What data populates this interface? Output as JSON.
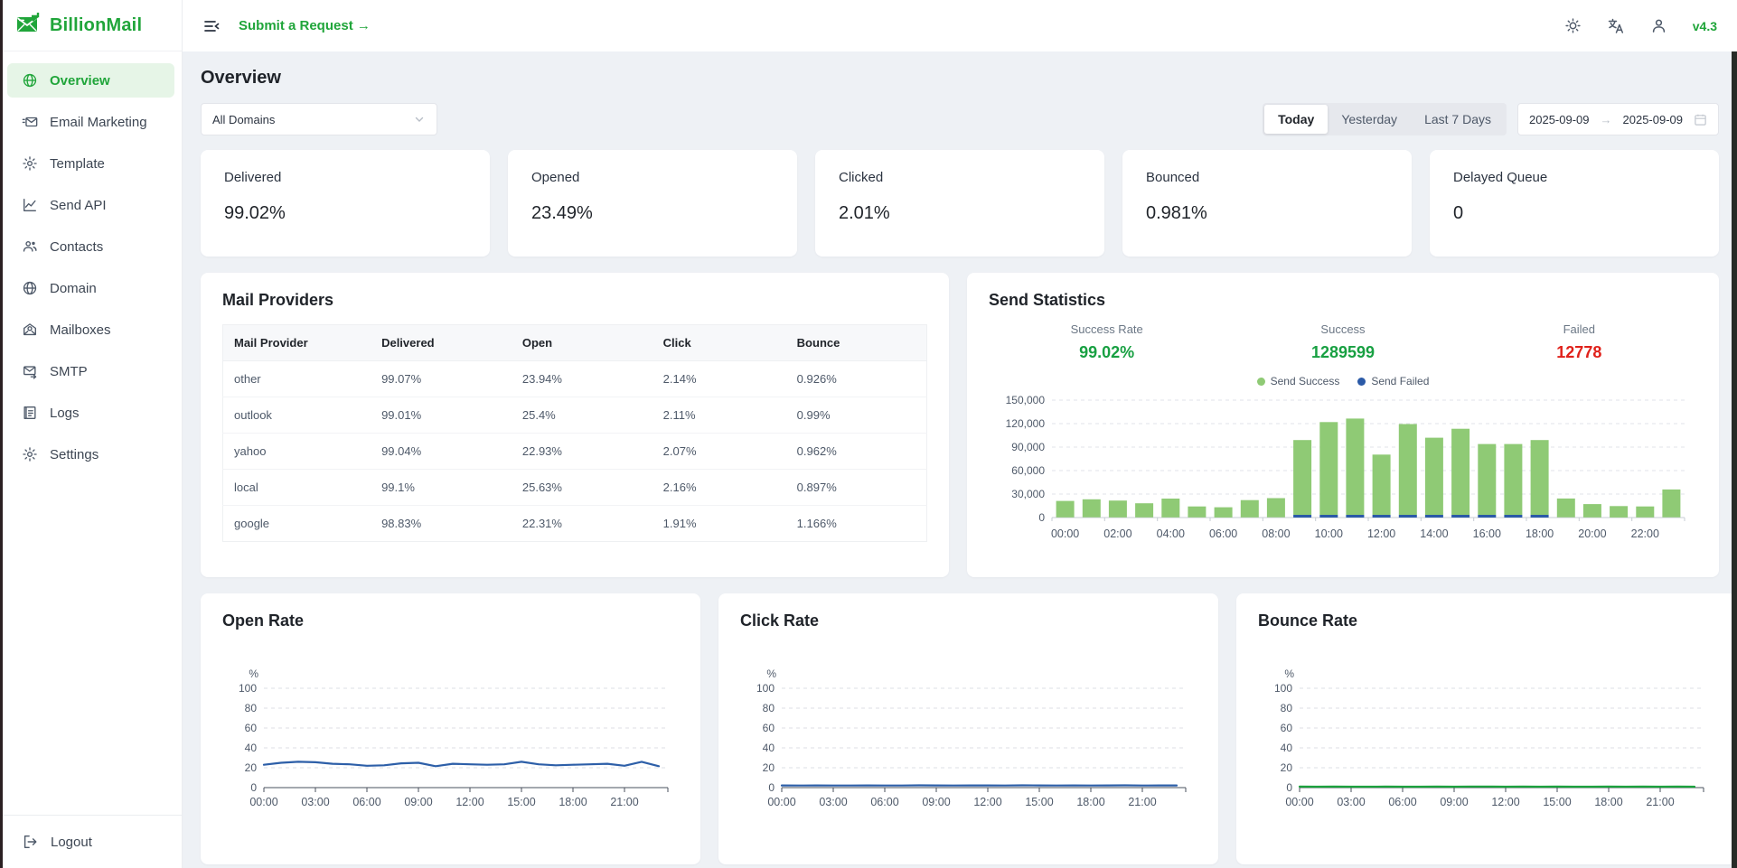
{
  "app": {
    "name": "BillionMail",
    "version": "v4.3"
  },
  "topbar": {
    "submit_request": "Submit a Request →"
  },
  "sidebar": {
    "items": [
      {
        "label": "Overview",
        "icon": "globe-icon",
        "active": true
      },
      {
        "label": "Email Marketing",
        "icon": "email-campaign-icon",
        "active": false
      },
      {
        "label": "Template",
        "icon": "gear-icon",
        "active": false
      },
      {
        "label": "Send API",
        "icon": "chart-line-icon",
        "active": false
      },
      {
        "label": "Contacts",
        "icon": "contacts-icon",
        "active": false
      },
      {
        "label": "Domain",
        "icon": "globe-icon",
        "active": false
      },
      {
        "label": "Mailboxes",
        "icon": "mailbox-icon",
        "active": false
      },
      {
        "label": "SMTP",
        "icon": "envelope-arrow-icon",
        "active": false
      },
      {
        "label": "Logs",
        "icon": "logs-icon",
        "active": false
      },
      {
        "label": "Settings",
        "icon": "gear-icon",
        "active": false
      }
    ],
    "logout_label": "Logout"
  },
  "page": {
    "title": "Overview"
  },
  "filters": {
    "domain_select": {
      "value": "All Domains"
    },
    "range_tabs": [
      {
        "label": "Today",
        "active": true
      },
      {
        "label": "Yesterday",
        "active": false
      },
      {
        "label": "Last 7 Days",
        "active": false
      }
    ],
    "date_from": "2025-09-09",
    "date_arrow": "→",
    "date_to": "2025-09-09"
  },
  "stat_cards": [
    {
      "label": "Delivered",
      "value": "99.02%"
    },
    {
      "label": "Opened",
      "value": "23.49%"
    },
    {
      "label": "Clicked",
      "value": "2.01%"
    },
    {
      "label": "Bounced",
      "value": "0.981%"
    },
    {
      "label": "Delayed Queue",
      "value": "0"
    }
  ],
  "mail_providers": {
    "title": "Mail Providers",
    "columns": [
      "Mail Provider",
      "Delivered",
      "Open",
      "Click",
      "Bounce"
    ],
    "rows": [
      [
        "other",
        "99.07%",
        "23.94%",
        "2.14%",
        "0.926%"
      ],
      [
        "outlook",
        "99.01%",
        "25.4%",
        "2.11%",
        "0.99%"
      ],
      [
        "yahoo",
        "99.04%",
        "22.93%",
        "2.07%",
        "0.962%"
      ],
      [
        "local",
        "99.1%",
        "25.63%",
        "2.16%",
        "0.897%"
      ],
      [
        "google",
        "98.83%",
        "22.31%",
        "1.91%",
        "1.166%"
      ]
    ]
  },
  "send_statistics": {
    "title": "Send Statistics",
    "stats": [
      {
        "label": "Success Rate",
        "value": "99.02%",
        "color": "#18a042"
      },
      {
        "label": "Success",
        "value": "1289599",
        "color": "#18a042"
      },
      {
        "label": "Failed",
        "value": "12778",
        "color": "#e0211a"
      }
    ],
    "legend": [
      {
        "label": "Send Success",
        "color": "#8fca75"
      },
      {
        "label": "Send Failed",
        "color": "#2b5aa7"
      }
    ]
  },
  "colors": {
    "accent_green": "#20a53a",
    "bar_green": "#8fca75",
    "failed_blue": "#2b5aa7",
    "line_blue": "#2d5fa8",
    "line_green": "#1ba13d",
    "success_text": "#18a042",
    "failed_text": "#e0211a"
  },
  "chart_data": [
    {
      "id": "send_stats_bar",
      "type": "bar",
      "title": "Send Statistics",
      "stacked": true,
      "x": [
        "00:00",
        "01:00",
        "02:00",
        "03:00",
        "04:00",
        "05:00",
        "06:00",
        "07:00",
        "08:00",
        "09:00",
        "10:00",
        "11:00",
        "12:00",
        "13:00",
        "14:00",
        "15:00",
        "16:00",
        "17:00",
        "18:00",
        "19:00",
        "20:00",
        "21:00",
        "22:00",
        "23:00"
      ],
      "xtick_every": 2,
      "series": [
        {
          "name": "Send Failed",
          "color": "#2b5aa7",
          "values": [
            250,
            250,
            250,
            200,
            250,
            150,
            150,
            250,
            300,
            1200,
            1500,
            1500,
            1000,
            1400,
            1300,
            1400,
            1200,
            1200,
            1200,
            300,
            200,
            150,
            150,
            400
          ]
        },
        {
          "name": "Send Success",
          "color": "#8fca75",
          "values": [
            21000,
            23000,
            21500,
            18000,
            24000,
            14000,
            13000,
            22000,
            24500,
            95500,
            118500,
            123000,
            77000,
            116000,
            98500,
            110000,
            90500,
            90500,
            95500,
            24000,
            17000,
            14500,
            14000,
            35500
          ]
        }
      ],
      "ylim": [
        0,
        150000
      ],
      "yticks": [
        0,
        30000,
        60000,
        90000,
        120000,
        150000
      ],
      "grid": true,
      "legend_position": "top"
    },
    {
      "id": "open_rate",
      "type": "line",
      "title": "Open Rate",
      "color": "#2d5fa8",
      "ylabel": "%",
      "x": [
        "00:00",
        "01:00",
        "02:00",
        "03:00",
        "04:00",
        "05:00",
        "06:00",
        "07:00",
        "08:00",
        "09:00",
        "10:00",
        "11:00",
        "12:00",
        "13:00",
        "14:00",
        "15:00",
        "16:00",
        "17:00",
        "18:00",
        "19:00",
        "20:00",
        "21:00",
        "22:00",
        "23:00"
      ],
      "xtick_every": 3,
      "values": [
        23,
        25,
        26,
        25.5,
        24,
        23.5,
        22,
        22.5,
        24.5,
        25,
        21.5,
        24,
        23.5,
        23,
        23.5,
        26,
        23.5,
        22.5,
        23,
        23.5,
        24,
        22,
        26,
        21.5
      ],
      "ylim": [
        0,
        100
      ],
      "yticks": [
        0,
        20,
        40,
        60,
        80,
        100
      ],
      "grid": true
    },
    {
      "id": "click_rate",
      "type": "line",
      "title": "Click Rate",
      "color": "#2d5fa8",
      "ylabel": "%",
      "x": [
        "00:00",
        "01:00",
        "02:00",
        "03:00",
        "04:00",
        "05:00",
        "06:00",
        "07:00",
        "08:00",
        "09:00",
        "10:00",
        "11:00",
        "12:00",
        "13:00",
        "14:00",
        "15:00",
        "16:00",
        "17:00",
        "18:00",
        "19:00",
        "20:00",
        "21:00",
        "22:00",
        "23:00"
      ],
      "xtick_every": 3,
      "values": [
        2.2,
        2.1,
        2.2,
        2.1,
        2.1,
        2.2,
        2.1,
        2.1,
        2.3,
        2.2,
        2.1,
        2.2,
        2.2,
        2.1,
        2.3,
        2.2,
        2.1,
        2.2,
        2.1,
        2.2,
        2.3,
        2.1,
        2.2,
        2.2
      ],
      "ylim": [
        0,
        100
      ],
      "yticks": [
        0,
        20,
        40,
        60,
        80,
        100
      ],
      "grid": true
    },
    {
      "id": "bounce_rate",
      "type": "line",
      "title": "Bounce Rate",
      "color": "#1ba13d",
      "ylabel": "%",
      "x": [
        "00:00",
        "01:00",
        "02:00",
        "03:00",
        "04:00",
        "05:00",
        "06:00",
        "07:00",
        "08:00",
        "09:00",
        "10:00",
        "11:00",
        "12:00",
        "13:00",
        "14:00",
        "15:00",
        "16:00",
        "17:00",
        "18:00",
        "19:00",
        "20:00",
        "21:00",
        "22:00",
        "23:00"
      ],
      "xtick_every": 3,
      "values": [
        1,
        0.95,
        1,
        0.9,
        0.95,
        1,
        0.9,
        0.95,
        1,
        0.95,
        1.05,
        1.1,
        0.95,
        1,
        0.95,
        1,
        0.9,
        0.95,
        1,
        0.95,
        1,
        0.9,
        1,
        0.95
      ],
      "ylim": [
        0,
        100
      ],
      "yticks": [
        0,
        20,
        40,
        60,
        80,
        100
      ],
      "grid": true
    }
  ]
}
